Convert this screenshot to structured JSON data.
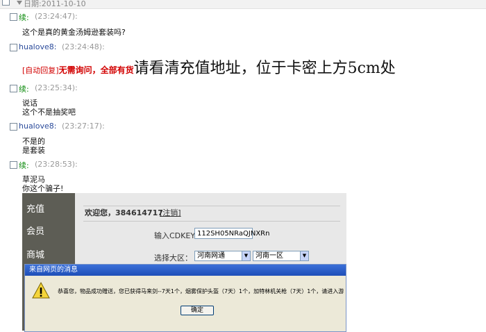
{
  "header": {
    "date_label": "日期:2011-10-10"
  },
  "messages": [
    {
      "sender": "续:",
      "time": "(23:24:47):",
      "lines": [
        "这个是真的黄金汤姆逊套装吗?"
      ]
    },
    {
      "sender": "hualove8:",
      "time": "(23:24:48):",
      "auto_tag": "[自动回复]",
      "bold": "无需询问，全部有货",
      "big": "请看清充值地址，位于卡密上方5cm处"
    },
    {
      "sender": "续:",
      "time": "(23:25:34):",
      "lines": [
        "说话",
        "这个不是抽奖吧"
      ]
    },
    {
      "sender": "hualove8:",
      "time": "(23:27:17):",
      "lines": [
        "不是的",
        "是套装"
      ]
    },
    {
      "sender": "续:",
      "time": "(23:28:53):",
      "lines": [
        "草泥马",
        "你这个骗子!"
      ]
    }
  ],
  "embedded_screenshot": {
    "menu": [
      "充值",
      "会员",
      "商城"
    ],
    "welcome_text": "欢迎您，384614717",
    "logout_link": "[注销]",
    "cdkey_label": "输入CDKEY：",
    "cdkey_value": "112SH05NRaQJNXRn",
    "region_label": "选择大区：",
    "region_value": "河南网通",
    "server_value": "河南一区",
    "dialog": {
      "title": "来自网页的消息",
      "text": "恭喜您，物品成功赠送，您已获得马来剑--7天1个，烟雾保护头盔（7天）1个，加特林机关枪（7天）1个，请进入游",
      "ok_label": "确定"
    }
  }
}
